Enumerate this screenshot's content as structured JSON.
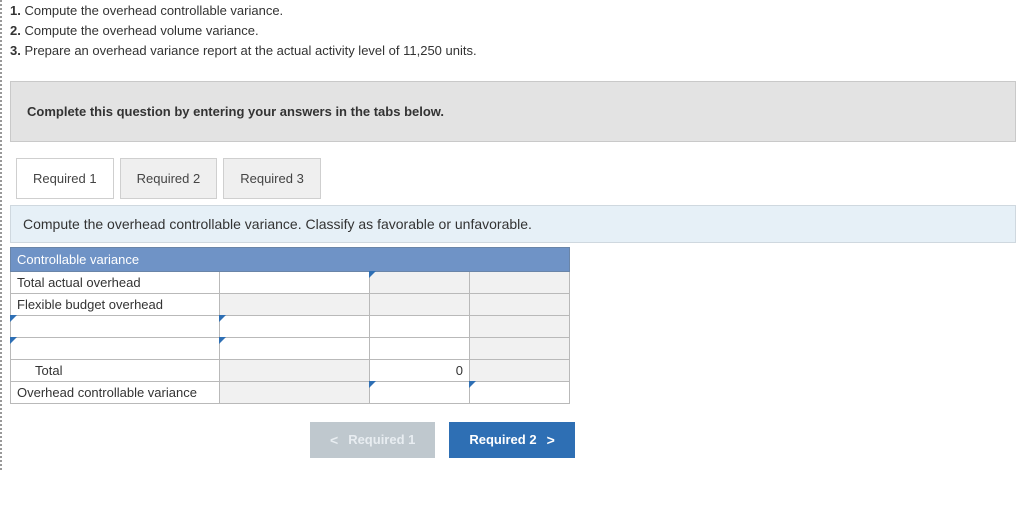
{
  "instructions": {
    "item1_num": "1.",
    "item1_text": " Compute the overhead controllable variance.",
    "item2_num": "2.",
    "item2_text": " Compute the overhead volume variance.",
    "item3_num": "3.",
    "item3_text": " Prepare an overhead variance report at the actual activity level of 11,250 units."
  },
  "banner": "Complete this question by entering your answers in the tabs below.",
  "tabs": {
    "t1": "Required 1",
    "t2": "Required 2",
    "t3": "Required 3"
  },
  "tab_instruction": "Compute the overhead controllable variance. Classify as favorable or unfavorable.",
  "table": {
    "header": "Controllable variance",
    "rows": {
      "r1_label": "Total actual overhead",
      "r2_label": "Flexible budget overhead",
      "r3_label": "",
      "r4_label": "",
      "total_label": "Total",
      "total_value": "0",
      "r6_label": "Overhead controllable variance"
    }
  },
  "nav": {
    "prev": "Required 1",
    "next": "Required 2"
  },
  "glyphs": {
    "left": "<",
    "right": ">"
  }
}
